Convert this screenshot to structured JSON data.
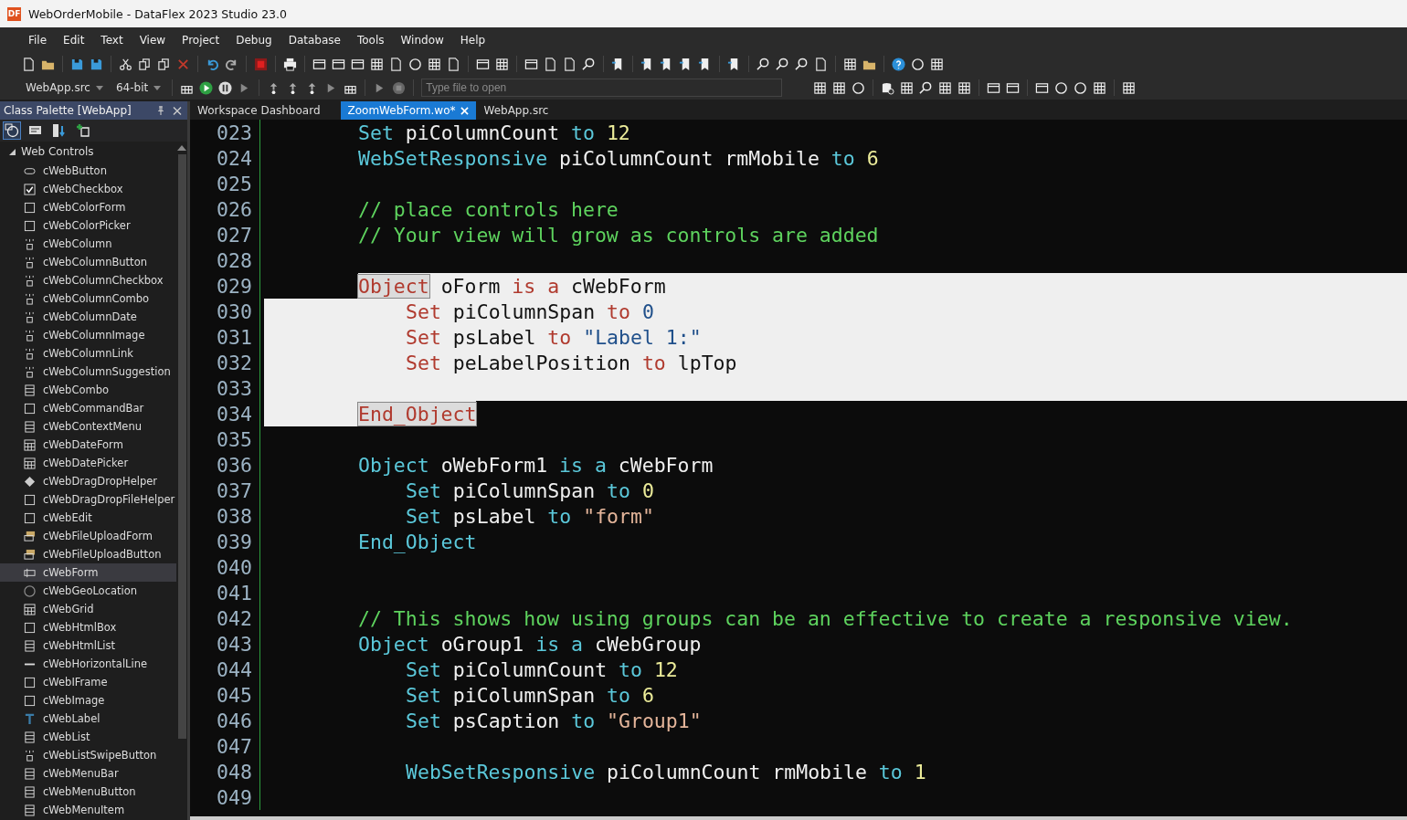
{
  "window": {
    "logo": "DF",
    "title": "WebOrderMobile - DataFlex 2023 Studio 23.0"
  },
  "menu": [
    "File",
    "Edit",
    "Text",
    "View",
    "Project",
    "Debug",
    "Database",
    "Tools",
    "Window",
    "Help"
  ],
  "toolbar": {
    "project_combo": "WebApp.src",
    "platform_combo": "64-bit",
    "file_search": {
      "placeholder": "Type file to open"
    }
  },
  "palette": {
    "title": "Class Palette [WebApp]",
    "groups": [
      {
        "label": "Web Controls",
        "expanded": true,
        "children": [
          {
            "label": "cWebButton",
            "selected": false
          },
          {
            "label": "cWebCheckbox",
            "selected": false
          },
          {
            "label": "cWebColorForm",
            "selected": false
          },
          {
            "label": "cWebColorPicker",
            "selected": false
          },
          {
            "label": "cWebColumn",
            "selected": false
          },
          {
            "label": "cWebColumnButton",
            "selected": false
          },
          {
            "label": "cWebColumnCheckbox",
            "selected": false
          },
          {
            "label": "cWebColumnCombo",
            "selected": false
          },
          {
            "label": "cWebColumnDate",
            "selected": false
          },
          {
            "label": "cWebColumnImage",
            "selected": false
          },
          {
            "label": "cWebColumnLink",
            "selected": false
          },
          {
            "label": "cWebColumnSuggestion",
            "selected": false
          },
          {
            "label": "cWebCombo",
            "selected": false
          },
          {
            "label": "cWebCommandBar",
            "selected": false
          },
          {
            "label": "cWebContextMenu",
            "selected": false
          },
          {
            "label": "cWebDateForm",
            "selected": false
          },
          {
            "label": "cWebDatePicker",
            "selected": false
          },
          {
            "label": "cWebDragDropHelper",
            "selected": false
          },
          {
            "label": "cWebDragDropFileHelper",
            "selected": false
          },
          {
            "label": "cWebEdit",
            "selected": false
          },
          {
            "label": "cWebFileUploadForm",
            "selected": false
          },
          {
            "label": "cWebFileUploadButton",
            "selected": false
          },
          {
            "label": "cWebForm",
            "selected": true
          },
          {
            "label": "cWebGeoLocation",
            "selected": false
          },
          {
            "label": "cWebGrid",
            "selected": false
          },
          {
            "label": "cWebHtmlBox",
            "selected": false
          },
          {
            "label": "cWebHtmlList",
            "selected": false
          },
          {
            "label": "cWebHorizontalLine",
            "selected": false
          },
          {
            "label": "cWebIFrame",
            "selected": false
          },
          {
            "label": "cWebImage",
            "selected": false
          },
          {
            "label": "cWebLabel",
            "selected": false
          },
          {
            "label": "cWebList",
            "selected": false
          },
          {
            "label": "cWebListSwipeButton",
            "selected": false
          },
          {
            "label": "cWebMenuBar",
            "selected": false
          },
          {
            "label": "cWebMenuButton",
            "selected": false
          },
          {
            "label": "cWebMenuItem",
            "selected": false
          }
        ]
      }
    ]
  },
  "tabs": [
    {
      "label": "Workspace Dashboard",
      "selected": false
    },
    {
      "label": "ZoomWebForm.wo*",
      "selected": true
    },
    {
      "label": "WebApp.src",
      "selected": false
    }
  ],
  "editor": {
    "lines": [
      {
        "number": "023",
        "kind": "statement",
        "selected": false,
        "tokens": [
          {
            "text": "Set",
            "kind": "keyword"
          },
          {
            "text": "piColumnCount",
            "kind": "plain"
          },
          {
            "text": "to",
            "kind": "keyword"
          },
          {
            "text": "12",
            "kind": "number"
          }
        ]
      },
      {
        "number": "024",
        "kind": "statement",
        "selected": false,
        "tokens": [
          {
            "text": "WebSetResponsive",
            "kind": "keyword"
          },
          {
            "text": "piColumnCount",
            "kind": "plain"
          },
          {
            "text": "rmMobile",
            "kind": "plain"
          },
          {
            "text": "to",
            "kind": "keyword"
          },
          {
            "text": "6",
            "kind": "number"
          }
        ]
      },
      {
        "number": "025",
        "kind": "blank",
        "selected": false
      },
      {
        "number": "026",
        "kind": "statement",
        "selected": false,
        "tokens": [
          {
            "text": "// place controls here",
            "kind": "comment"
          }
        ]
      },
      {
        "number": "027",
        "kind": "statement",
        "selected": false,
        "tokens": [
          {
            "text": "// Your view will grow as controls are added",
            "kind": "comment"
          }
        ]
      },
      {
        "number": "028",
        "kind": "blank",
        "selected": false
      },
      {
        "number": "029",
        "kind": "statement",
        "selected": true,
        "partial": true,
        "tokens": [
          {
            "text": "Object",
            "kind": "keyword",
            "match": true
          },
          {
            "text": "oForm",
            "kind": "plain"
          },
          {
            "text": "is",
            "kind": "keyword"
          },
          {
            "text": "a",
            "kind": "keyword"
          },
          {
            "text": "cWebForm",
            "kind": "plain"
          }
        ]
      },
      {
        "number": "030",
        "kind": "nested",
        "selected": true,
        "partial": false,
        "tokens": [
          {
            "text": "Set",
            "kind": "keyword"
          },
          {
            "text": "piColumnSpan",
            "kind": "plain"
          },
          {
            "text": "to",
            "kind": "keyword"
          },
          {
            "text": "0",
            "kind": "number"
          }
        ]
      },
      {
        "number": "031",
        "kind": "nested",
        "selected": true,
        "partial": false,
        "tokens": [
          {
            "text": "Set",
            "kind": "keyword"
          },
          {
            "text": "psLabel",
            "kind": "plain"
          },
          {
            "text": "to",
            "kind": "keyword"
          },
          {
            "text": "\"Label 1:\"",
            "kind": "string"
          }
        ]
      },
      {
        "number": "032",
        "kind": "nested",
        "selected": true,
        "partial": false,
        "tokens": [
          {
            "text": "Set",
            "kind": "keyword"
          },
          {
            "text": "peLabelPosition",
            "kind": "plain"
          },
          {
            "text": "to",
            "kind": "keyword"
          },
          {
            "text": "lpTop",
            "kind": "plain"
          }
        ]
      },
      {
        "number": "033",
        "kind": "blank",
        "selected": true,
        "partial": false
      },
      {
        "number": "034",
        "kind": "statement",
        "selected": true,
        "partial": true,
        "tokens": [
          {
            "text": "End_Object",
            "kind": "keyword",
            "match": true
          }
        ]
      },
      {
        "number": "035",
        "kind": "blank",
        "selected": false
      },
      {
        "number": "036",
        "kind": "statement",
        "selected": false,
        "tokens": [
          {
            "text": "Object",
            "kind": "keyword"
          },
          {
            "text": "oWebForm1",
            "kind": "plain"
          },
          {
            "text": "is",
            "kind": "keyword"
          },
          {
            "text": "a",
            "kind": "keyword"
          },
          {
            "text": "cWebForm",
            "kind": "plain"
          }
        ]
      },
      {
        "number": "037",
        "kind": "nested",
        "selected": false,
        "tokens": [
          {
            "text": "Set",
            "kind": "keyword"
          },
          {
            "text": "piColumnSpan",
            "kind": "plain"
          },
          {
            "text": "to",
            "kind": "keyword"
          },
          {
            "text": "0",
            "kind": "number"
          }
        ]
      },
      {
        "number": "038",
        "kind": "nested",
        "selected": false,
        "tokens": [
          {
            "text": "Set",
            "kind": "keyword"
          },
          {
            "text": "psLabel",
            "kind": "plain"
          },
          {
            "text": "to",
            "kind": "keyword"
          },
          {
            "text": "\"form\"",
            "kind": "string"
          }
        ]
      },
      {
        "number": "039",
        "kind": "statement",
        "selected": false,
        "tokens": [
          {
            "text": "End_Object",
            "kind": "keyword"
          }
        ]
      },
      {
        "number": "040",
        "kind": "blank",
        "selected": false
      },
      {
        "number": "041",
        "kind": "blank",
        "selected": false
      },
      {
        "number": "042",
        "kind": "statement",
        "selected": false,
        "tokens": [
          {
            "text": "// This shows how using groups can be an effective to create a responsive view.",
            "kind": "comment"
          }
        ]
      },
      {
        "number": "043",
        "kind": "statement",
        "selected": false,
        "tokens": [
          {
            "text": "Object",
            "kind": "keyword"
          },
          {
            "text": "oGroup1",
            "kind": "plain"
          },
          {
            "text": "is",
            "kind": "keyword"
          },
          {
            "text": "a",
            "kind": "keyword"
          },
          {
            "text": "cWebGroup",
            "kind": "plain"
          }
        ]
      },
      {
        "number": "044",
        "kind": "nested",
        "selected": false,
        "tokens": [
          {
            "text": "Set",
            "kind": "keyword"
          },
          {
            "text": "piColumnCount",
            "kind": "plain"
          },
          {
            "text": "to",
            "kind": "keyword"
          },
          {
            "text": "12",
            "kind": "number"
          }
        ]
      },
      {
        "number": "045",
        "kind": "nested",
        "selected": false,
        "tokens": [
          {
            "text": "Set",
            "kind": "keyword"
          },
          {
            "text": "piColumnSpan",
            "kind": "plain"
          },
          {
            "text": "to",
            "kind": "keyword"
          },
          {
            "text": "6",
            "kind": "number"
          }
        ]
      },
      {
        "number": "046",
        "kind": "nested",
        "selected": false,
        "tokens": [
          {
            "text": "Set",
            "kind": "keyword"
          },
          {
            "text": "psCaption",
            "kind": "plain"
          },
          {
            "text": "to",
            "kind": "keyword"
          },
          {
            "text": "\"Group1\"",
            "kind": "string"
          }
        ]
      },
      {
        "number": "047",
        "kind": "blank",
        "selected": false
      },
      {
        "number": "048",
        "kind": "nested",
        "selected": false,
        "tokens": [
          {
            "text": "WebSetResponsive",
            "kind": "keyword"
          },
          {
            "text": "piColumnCount",
            "kind": "plain"
          },
          {
            "text": "rmMobile",
            "kind": "plain"
          },
          {
            "text": "to",
            "kind": "keyword"
          },
          {
            "text": "1",
            "kind": "number"
          }
        ]
      },
      {
        "number": "049",
        "kind": "blank",
        "selected": false
      }
    ]
  }
}
